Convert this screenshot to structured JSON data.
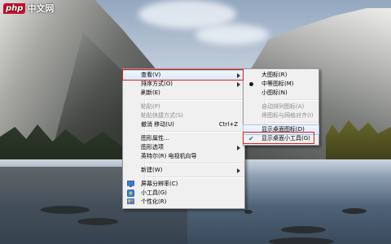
{
  "logo": {
    "brand": "php",
    "site": "中文网"
  },
  "context_menu": {
    "items": [
      {
        "label": "查看(V)",
        "submenu": true,
        "highlighted": true
      },
      {
        "label": "排序方式(O)",
        "submenu": true
      },
      {
        "label": "刷新(E)"
      },
      {
        "label": "粘贴(P)",
        "disabled": true
      },
      {
        "label": "粘贴快捷方式(S)",
        "disabled": true
      },
      {
        "label": "撤消 移动(U)",
        "shortcut": "Ctrl+Z"
      },
      {
        "label": "图形属性..."
      },
      {
        "label": "图形选项",
        "submenu": true
      },
      {
        "label": "英特尔(R) 电视机向导"
      },
      {
        "label": "新建(W)",
        "submenu": true
      },
      {
        "label": "屏幕分辨率(C)",
        "icon": "monitor-icon"
      },
      {
        "label": "小工具(G)",
        "icon": "gadget-icon"
      },
      {
        "label": "个性化(R)",
        "icon": "personalize-icon"
      }
    ]
  },
  "view_submenu": {
    "items": [
      {
        "label": "大图标(R)"
      },
      {
        "label": "中等图标(M)",
        "selected": true
      },
      {
        "label": "小图标(N)"
      },
      {
        "label": "自动排列图标(A)",
        "disabled": true
      },
      {
        "label": "将图标与网格对齐(I)",
        "disabled": true
      },
      {
        "label": "显示桌面图标(D)",
        "highlighted": true
      },
      {
        "label": "显示桌面小工具(G)",
        "checked": true
      }
    ]
  },
  "colors": {
    "highlight_border": "#e0201a",
    "menu_bg": "#f0f0f0",
    "brand_red": "#c8102e"
  }
}
